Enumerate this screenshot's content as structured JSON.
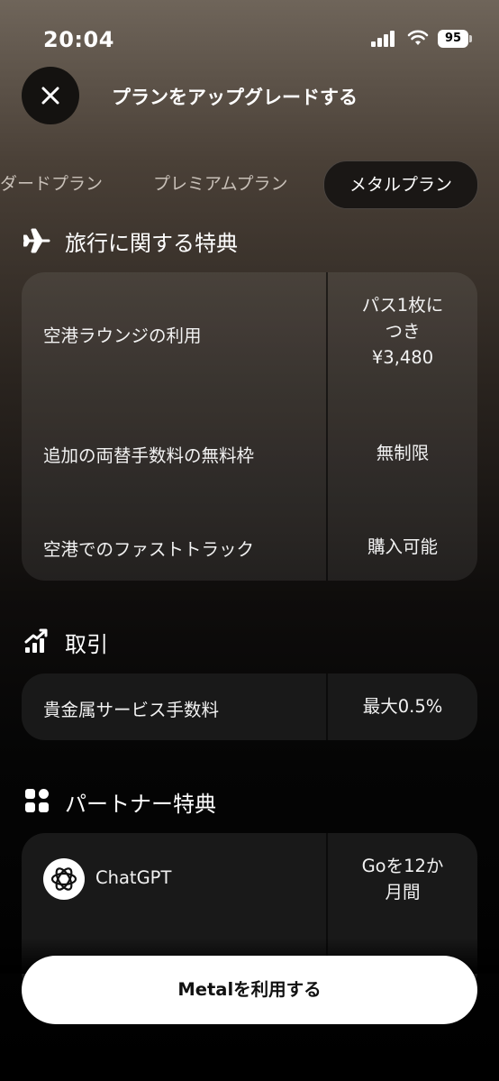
{
  "status_bar": {
    "time": "20:04",
    "battery": "95"
  },
  "header": {
    "title": "プランをアップグレードする"
  },
  "tabs": [
    {
      "label": "ダードプラン"
    },
    {
      "label": "プレミアムプラン"
    },
    {
      "label": "メタルプラン",
      "selected": true
    }
  ],
  "travel": {
    "title": "旅行に関する特典",
    "rows": [
      {
        "label": "空港ラウンジの利用",
        "value_lines": [
          "パス1枚に",
          "つき",
          "¥3,480"
        ]
      },
      {
        "label": "追加の両替手数料の無料枠",
        "value": "無制限"
      },
      {
        "label": "空港でのファストトラック",
        "value": "購入可能"
      }
    ]
  },
  "trading": {
    "title": "取引",
    "rows": [
      {
        "label": "貴金属サービス手数料",
        "value": "最大0.5%"
      }
    ]
  },
  "partners": {
    "title": "パートナー特典",
    "rows": [
      {
        "label": "ChatGPT",
        "value_lines": [
          "Goを12か",
          "月間"
        ]
      }
    ]
  },
  "cta": {
    "label": "Metalを利用する"
  },
  "icons": {
    "close": "close-icon",
    "airplane": "airplane-icon",
    "trading": "chart-growth-icon",
    "partners": "apps-grid-icon",
    "chatgpt": "openai-logo-icon"
  }
}
